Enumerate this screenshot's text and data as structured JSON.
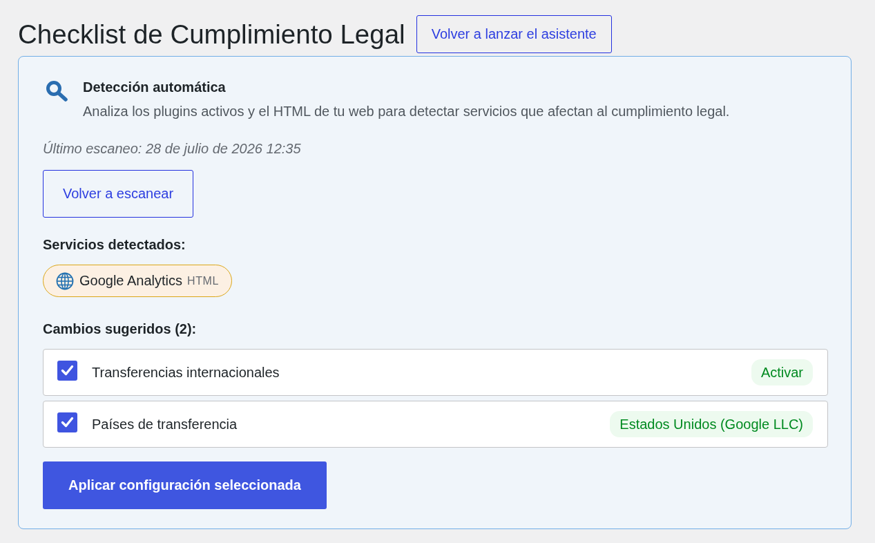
{
  "page": {
    "title": "Checklist de Cumplimiento Legal",
    "relaunch_button": "Volver a lanzar el asistente"
  },
  "detection": {
    "title": "Detección automática",
    "description": "Analiza los plugins activos y el HTML de tu web para detectar servicios que afectan al cumplimiento legal.",
    "last_scan": "Último escaneo: 28 de julio de 2026 12:35",
    "rescan_button": "Volver a escanear"
  },
  "services": {
    "heading": "Servicios detectados:",
    "items": [
      {
        "name": "Google Analytics",
        "source": "HTML"
      }
    ]
  },
  "changes": {
    "heading": "Cambios sugeridos (2):",
    "items": [
      {
        "label": "Transferencias internacionales",
        "checked": true,
        "value": "Activar"
      },
      {
        "label": "Países de transferencia",
        "checked": true,
        "value": "Estados Unidos (Google LLC)"
      }
    ]
  },
  "apply_button": "Aplicar configuración seleccionada"
}
